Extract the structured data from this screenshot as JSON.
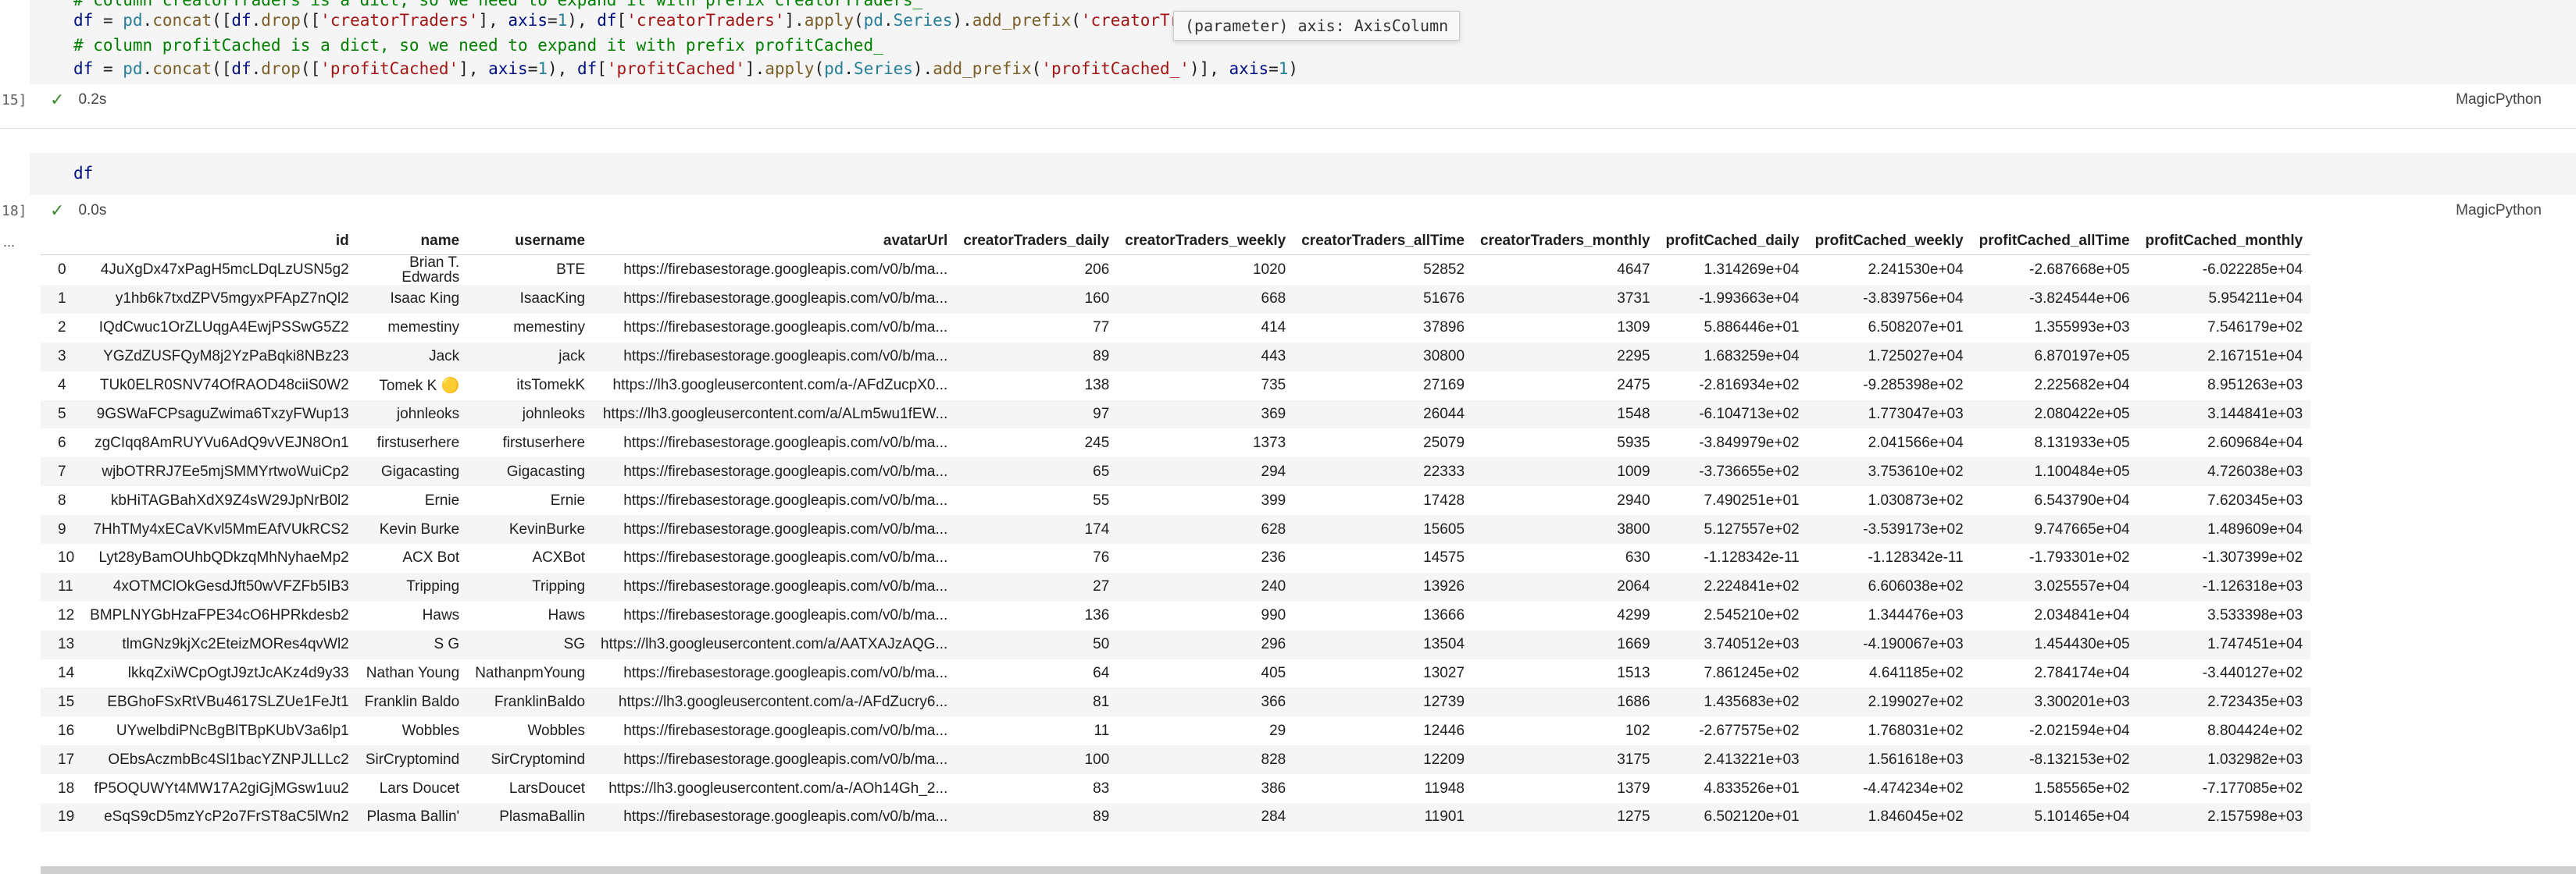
{
  "cell15": {
    "number": "15]",
    "lines": [
      {
        "k": "comment",
        "t": "# column creatorTraders is a dict, so we need to expand it with prefix creatorTraders_"
      },
      {
        "k": "code1"
      },
      {
        "k": "comment2",
        "t": "# column profitCached is a dict, so we need to expand it with prefix profitCached_"
      },
      {
        "k": "code2"
      }
    ],
    "hover": "(parameter) axis: AxisColumn",
    "status_time": "0.2s",
    "language": "MagicPython"
  },
  "cell18": {
    "number": "18]",
    "code": "df",
    "status_time": "0.0s",
    "language": "MagicPython",
    "output_marker": "..."
  },
  "table": {
    "columns": [
      "",
      "id",
      "name",
      "username",
      "avatarUrl",
      "creatorTraders_daily",
      "creatorTraders_weekly",
      "creatorTraders_allTime",
      "creatorTraders_monthly",
      "profitCached_daily",
      "profitCached_weekly",
      "profitCached_allTime",
      "profitCached_monthly"
    ],
    "rows": [
      [
        "0",
        "4JuXgDx47xPagH5mcLDqLzUSN5g2",
        "Brian T. Edwards",
        "BTE",
        "https://firebasestorage.googleapis.com/v0/b/ma...",
        "206",
        "1020",
        "52852",
        "4647",
        "1.314269e+04",
        "2.241530e+04",
        "-2.687668e+05",
        "-6.022285e+04"
      ],
      [
        "1",
        "y1hb6k7txdZPV5mgyxPFApZ7nQl2",
        "Isaac King",
        "IsaacKing",
        "https://firebasestorage.googleapis.com/v0/b/ma...",
        "160",
        "668",
        "51676",
        "3731",
        "-1.993663e+04",
        "-3.839756e+04",
        "-3.824544e+06",
        "5.954211e+04"
      ],
      [
        "2",
        "IQdCwuc1OrZLUqgA4EwjPSSwG5Z2",
        "memestiny",
        "memestiny",
        "https://firebasestorage.googleapis.com/v0/b/ma...",
        "77",
        "414",
        "37896",
        "1309",
        "5.886446e+01",
        "6.508207e+01",
        "1.355993e+03",
        "7.546179e+02"
      ],
      [
        "3",
        "YGZdZUSFQyM8j2YzPaBqki8NBz23",
        "Jack",
        "jack",
        "https://firebasestorage.googleapis.com/v0/b/ma...",
        "89",
        "443",
        "30800",
        "2295",
        "1.683259e+04",
        "1.725027e+04",
        "6.870197e+05",
        "2.167151e+04"
      ],
      [
        "4",
        "TUk0ELR0SNV74OfRAOD48ciiS0W2",
        "Tomek K 🟡",
        "itsTomekK",
        "https://lh3.googleusercontent.com/a-/AFdZucpX0...",
        "138",
        "735",
        "27169",
        "2475",
        "-2.816934e+02",
        "-9.285398e+02",
        "2.225682e+04",
        "8.951263e+03"
      ],
      [
        "5",
        "9GSWaFCPsaguZwima6TxzyFWup13",
        "johnleoks",
        "johnleoks",
        "https://lh3.googleusercontent.com/a/ALm5wu1fEW...",
        "97",
        "369",
        "26044",
        "1548",
        "-6.104713e+02",
        "1.773047e+03",
        "2.080422e+05",
        "3.144841e+03"
      ],
      [
        "6",
        "zgCIqq8AmRUYVu6AdQ9vVEJN8On1",
        "firstuserhere",
        "firstuserhere",
        "https://firebasestorage.googleapis.com/v0/b/ma...",
        "245",
        "1373",
        "25079",
        "5935",
        "-3.849979e+02",
        "2.041566e+04",
        "8.131933e+05",
        "2.609684e+04"
      ],
      [
        "7",
        "wjbOTRRJ7Ee5mjSMMYrtwoWuiCp2",
        "Gigacasting",
        "Gigacasting",
        "https://firebasestorage.googleapis.com/v0/b/ma...",
        "65",
        "294",
        "22333",
        "1009",
        "-3.736655e+02",
        "3.753610e+02",
        "1.100484e+05",
        "4.726038e+03"
      ],
      [
        "8",
        "kbHiTAGBahXdX9Z4sW29JpNrB0l2",
        "Ernie",
        "Ernie",
        "https://firebasestorage.googleapis.com/v0/b/ma...",
        "55",
        "399",
        "17428",
        "2940",
        "7.490251e+01",
        "1.030873e+02",
        "6.543790e+04",
        "7.620345e+03"
      ],
      [
        "9",
        "7HhTMy4xECaVKvl5MmEAfVUkRCS2",
        "Kevin Burke",
        "KevinBurke",
        "https://firebasestorage.googleapis.com/v0/b/ma...",
        "174",
        "628",
        "15605",
        "3800",
        "5.127557e+02",
        "-3.539173e+02",
        "9.747665e+04",
        "1.489609e+04"
      ],
      [
        "10",
        "Lyt28yBamOUhbQDkzqMhNyhaeMp2",
        "ACX Bot",
        "ACXBot",
        "https://firebasestorage.googleapis.com/v0/b/ma...",
        "76",
        "236",
        "14575",
        "630",
        "-1.128342e-11",
        "-1.128342e-11",
        "-1.793301e+02",
        "-1.307399e+02"
      ],
      [
        "11",
        "4xOTMClOkGesdJft50wVFZFb5IB3",
        "Tripping",
        "Tripping",
        "https://firebasestorage.googleapis.com/v0/b/ma...",
        "27",
        "240",
        "13926",
        "2064",
        "2.224841e+02",
        "6.606038e+02",
        "3.025557e+04",
        "-1.126318e+03"
      ],
      [
        "12",
        "BMPLNYGbHzaFPE34cO6HPRkdesb2",
        "Haws",
        "Haws",
        "https://firebasestorage.googleapis.com/v0/b/ma...",
        "136",
        "990",
        "13666",
        "4299",
        "2.545210e+02",
        "1.344476e+03",
        "2.034841e+04",
        "3.533398e+03"
      ],
      [
        "13",
        "tlmGNz9kjXc2EteizMORes4qvWl2",
        "S G",
        "SG",
        "https://lh3.googleusercontent.com/a/AATXAJzAQG...",
        "50",
        "296",
        "13504",
        "1669",
        "3.740512e+03",
        "-4.190067e+03",
        "1.454430e+05",
        "1.747451e+04"
      ],
      [
        "14",
        "lkkqZxiWCpOgtJ9ztJcAKz4d9y33",
        "Nathan Young",
        "NathanpmYoung",
        "https://firebasestorage.googleapis.com/v0/b/ma...",
        "64",
        "405",
        "13027",
        "1513",
        "7.861245e+02",
        "4.641185e+02",
        "2.784174e+04",
        "-3.440127e+02"
      ],
      [
        "15",
        "EBGhoFSxRtVBu4617SLZUe1FeJt1",
        "Franklin Baldo",
        "FranklinBaldo",
        "https://lh3.googleusercontent.com/a-/AFdZucry6...",
        "81",
        "366",
        "12739",
        "1686",
        "1.435683e+02",
        "2.199027e+02",
        "3.300201e+03",
        "2.723435e+03"
      ],
      [
        "16",
        "UYwelbdiPNcBgBlTBpKUbV3a6lp1",
        "Wobbles",
        "Wobbles",
        "https://firebasestorage.googleapis.com/v0/b/ma...",
        "11",
        "29",
        "12446",
        "102",
        "-2.677575e+02",
        "1.768031e+02",
        "-2.021594e+04",
        "8.804424e+02"
      ],
      [
        "17",
        "OEbsAczmbBc4Sl1bacYZNPJLLLc2",
        "SirCryptomind",
        "SirCryptomind",
        "https://firebasestorage.googleapis.com/v0/b/ma...",
        "100",
        "828",
        "12209",
        "3175",
        "2.413221e+03",
        "1.561618e+03",
        "-8.132153e+02",
        "1.032982e+03"
      ],
      [
        "18",
        "fP5OQUWYt4MW17A2giGjMGsw1uu2",
        "Lars Doucet",
        "LarsDoucet",
        "https://lh3.googleusercontent.com/a-/AOh14Gh_2...",
        "83",
        "386",
        "11948",
        "1379",
        "4.833526e+01",
        "-4.474234e+02",
        "1.585565e+02",
        "-7.177085e+02"
      ],
      [
        "19",
        "eSqS9cD5mzYcP2o7FrST8aC5lWn2",
        "Plasma Ballin'",
        "PlasmaBallin",
        "https://firebasestorage.googleapis.com/v0/b/ma...",
        "89",
        "284",
        "11901",
        "1275",
        "6.502120e+01",
        "1.846045e+02",
        "5.101465e+04",
        "2.157598e+03"
      ]
    ]
  }
}
